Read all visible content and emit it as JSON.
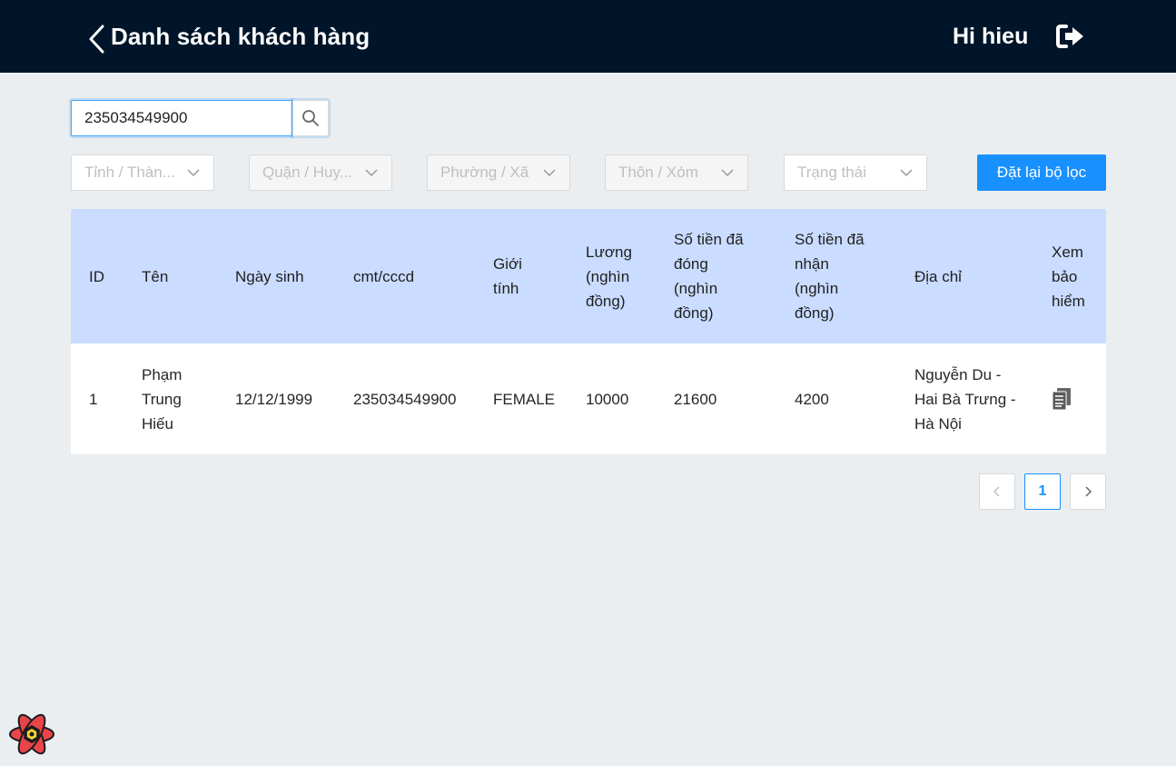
{
  "header": {
    "title": "Danh sách khách hàng",
    "greeting": "Hi hieu",
    "background": "#001529"
  },
  "search": {
    "value": "235034549900",
    "icon": "search-icon"
  },
  "filters": {
    "province": "Tỉnh / Thàn...",
    "district": "Quận / Huy...",
    "ward": "Phường / Xã",
    "hamlet": "Thôn / Xóm",
    "status": "Trạng thái",
    "reset_label": "Đặt lại bộ lọc"
  },
  "table": {
    "columns": [
      "ID",
      "Tên",
      "Ngày sinh",
      "cmt/cccd",
      "Giới tính",
      "Lương (nghìn đồng)",
      "Số tiền đã đóng (nghìn đồng)",
      "Số tiền đã nhận (nghìn đồng)",
      "Địa chỉ",
      "Xem bảo hiểm"
    ],
    "rows": [
      {
        "id": "1",
        "name": "Phạm Trung Hiếu",
        "dob": "12/12/1999",
        "idcard": "235034549900",
        "gender": "FEMALE",
        "salary": "10000",
        "paid": "21600",
        "received": "4200",
        "address": "Nguyễn Du - Hai Bà Trưng - Hà Nội",
        "view_icon": "document-icon"
      }
    ]
  },
  "pagination": {
    "current": "1"
  },
  "colors": {
    "accent": "#1890ff",
    "table_header": "#cadcff"
  }
}
